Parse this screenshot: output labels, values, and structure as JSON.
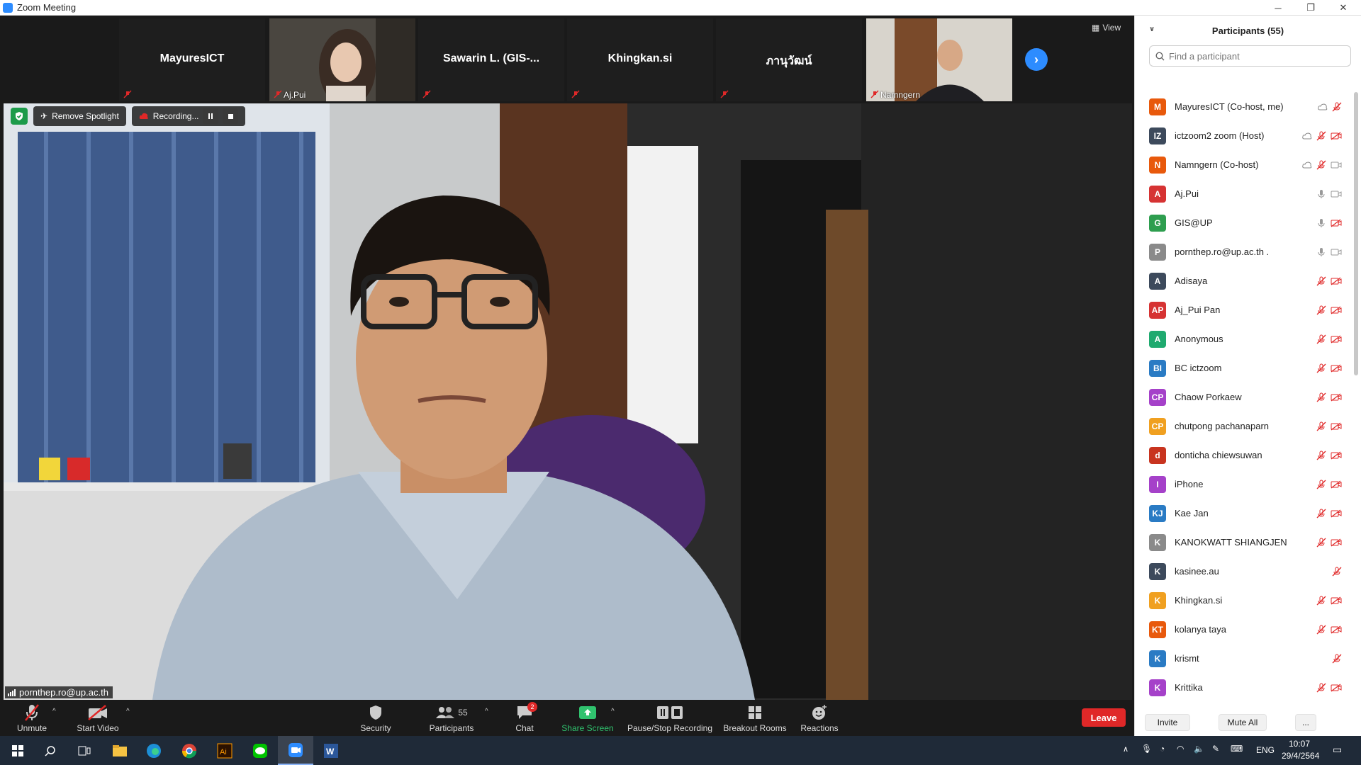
{
  "window": {
    "title": "Zoom Meeting",
    "controls": [
      "─",
      "❐",
      "✕"
    ]
  },
  "thumbnails": [
    {
      "name": "MayuresICT",
      "type": "name",
      "muted": true
    },
    {
      "name": "Aj.Pui",
      "type": "video",
      "muted": true
    },
    {
      "name": "Sawarin L. (GIS-...",
      "type": "name",
      "muted": true
    },
    {
      "name": "Khingkan.si",
      "type": "name",
      "muted": true
    },
    {
      "name": "ภานุวัฒน์",
      "type": "name",
      "muted": true
    },
    {
      "name": "Namngern",
      "type": "video",
      "muted": true
    }
  ],
  "view_label": "View",
  "main_video": {
    "spotlight_label": "Remove Spotlight",
    "recording_label": "Recording...",
    "speaker_name": "pornthep.ro@up.ac.th"
  },
  "toolbar": {
    "unmute": "Unmute",
    "start_video": "Start Video",
    "security": "Security",
    "participants": "Participants",
    "participants_count": "55",
    "chat": "Chat",
    "chat_badge": "2",
    "share_screen": "Share Screen",
    "pause_stop_recording": "Pause/Stop Recording",
    "breakout_rooms": "Breakout Rooms",
    "reactions": "Reactions",
    "leave": "Leave"
  },
  "panel": {
    "title": "Participants (55)",
    "search_placeholder": "Find a participant",
    "invite": "Invite",
    "mute_all": "Mute All",
    "more": "...",
    "participants": [
      {
        "initials": "M",
        "name": "MayuresICT (Co-host, me)",
        "color": "#e8590c",
        "rec": true,
        "mic": "muted",
        "video": "none"
      },
      {
        "initials": "IZ",
        "name": "ictzoom2 zoom (Host)",
        "color": "#3d4a5c",
        "rec": true,
        "mic": "muted",
        "video": "off"
      },
      {
        "initials": "N",
        "name": "Namngern (Co-host)",
        "color": "#e8590c",
        "rec": true,
        "mic": "muted",
        "video": "on"
      },
      {
        "initials": "A",
        "name": "Aj.Pui",
        "color": "#d63333",
        "rec": false,
        "mic": "on",
        "video": "on"
      },
      {
        "initials": "G",
        "name": "GIS@UP",
        "color": "#2e9e4f",
        "rec": false,
        "mic": "on",
        "video": "off"
      },
      {
        "initials": "P",
        "name": "pornthep.ro@up.ac.th .",
        "color": "#8a8a8a",
        "rec": false,
        "mic": "on",
        "video": "on"
      },
      {
        "initials": "A",
        "name": "Adisaya",
        "color": "#3d4a5c",
        "rec": false,
        "mic": "muted",
        "video": "off"
      },
      {
        "initials": "AP",
        "name": "Aj_Pui Pan",
        "color": "#d63333",
        "rec": false,
        "mic": "muted",
        "video": "off"
      },
      {
        "initials": "A",
        "name": "Anonymous",
        "color": "#1faa6f",
        "rec": false,
        "mic": "muted",
        "video": "off"
      },
      {
        "initials": "BI",
        "name": "BC ictzoom",
        "color": "#2a7bc4",
        "rec": false,
        "mic": "muted",
        "video": "off"
      },
      {
        "initials": "CP",
        "name": "Chaow Porkaew",
        "color": "#a541c9",
        "rec": false,
        "mic": "muted",
        "video": "off"
      },
      {
        "initials": "CP",
        "name": "chutpong pachanaparn",
        "color": "#f0a020",
        "rec": false,
        "mic": "muted",
        "video": "off"
      },
      {
        "initials": "d",
        "name": "donticha chiewsuwan",
        "color": "#c8341f",
        "rec": false,
        "mic": "muted",
        "video": "off"
      },
      {
        "initials": "I",
        "name": "iPhone",
        "color": "#a541c9",
        "rec": false,
        "mic": "muted",
        "video": "off"
      },
      {
        "initials": "KJ",
        "name": "Kae Jan",
        "color": "#2a7bc4",
        "rec": false,
        "mic": "muted",
        "video": "off"
      },
      {
        "initials": "K",
        "name": "KANOKWATT SHIANGJEN",
        "color": "#8a8a8a",
        "rec": false,
        "mic": "muted",
        "video": "off"
      },
      {
        "initials": "K",
        "name": "kasinee.au",
        "color": "#3d4a5c",
        "rec": false,
        "mic": "muted",
        "video": "none"
      },
      {
        "initials": "K",
        "name": "Khingkan.si",
        "color": "#f0a020",
        "rec": false,
        "mic": "muted",
        "video": "off"
      },
      {
        "initials": "KT",
        "name": "kolanya taya",
        "color": "#e8590c",
        "rec": false,
        "mic": "muted",
        "video": "off"
      },
      {
        "initials": "K",
        "name": "krismt",
        "color": "#2a7bc4",
        "rec": false,
        "mic": "muted",
        "video": "none"
      },
      {
        "initials": "K",
        "name": "Krittika",
        "color": "#a541c9",
        "rec": false,
        "mic": "muted",
        "video": "off"
      }
    ]
  },
  "taskbar": {
    "lang": "ENG",
    "time": "10:07",
    "date": "29/4/2564"
  }
}
